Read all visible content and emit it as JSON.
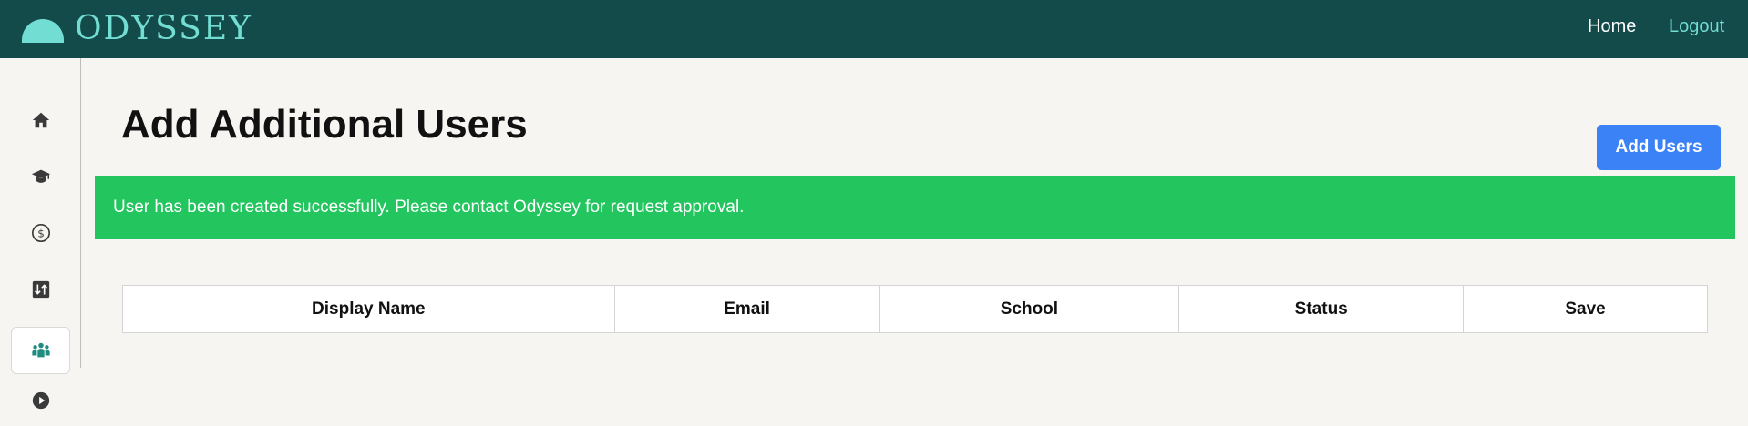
{
  "header": {
    "brand": "ODYSSEY",
    "nav": {
      "home": "Home",
      "logout": "Logout"
    }
  },
  "sidebar": {
    "items": [
      {
        "icon": "home-icon",
        "active": false
      },
      {
        "icon": "graduation-cap-icon",
        "active": false
      },
      {
        "icon": "dollar-circle-icon",
        "active": false
      },
      {
        "icon": "sort-adjust-icon",
        "active": false
      },
      {
        "icon": "users-group-icon",
        "active": true
      },
      {
        "icon": "play-circle-icon",
        "active": false
      }
    ]
  },
  "main": {
    "title": "Add Additional Users",
    "add_button_label": "Add Users",
    "alert_message": "User has been created successfully. Please contact Odyssey for request approval.",
    "table": {
      "columns": [
        "Display Name",
        "Email",
        "School",
        "Status",
        "Save"
      ],
      "rows": []
    }
  },
  "colors": {
    "header_bg": "#134b4b",
    "brand_accent": "#72ddd2",
    "primary_button": "#3b82f6",
    "success_alert": "#22c55e",
    "active_icon": "#1f8c80",
    "page_bg": "#f7f5f1"
  }
}
